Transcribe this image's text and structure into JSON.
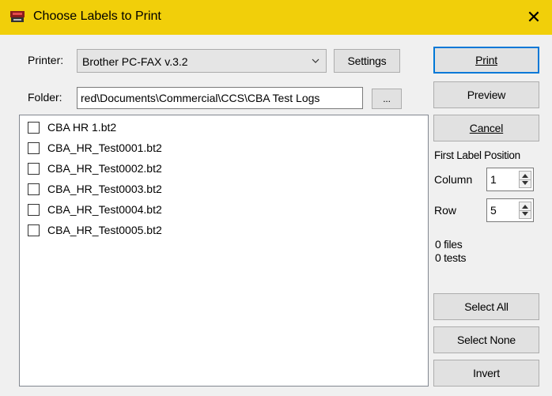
{
  "window": {
    "title": "Choose Labels to Print",
    "close_glyph": "✕",
    "app_icon": "label-printer-icon"
  },
  "printer": {
    "label": "Printer:",
    "selected": "Brother PC-FAX v.3.2",
    "settings_button": "Settings"
  },
  "folder": {
    "label": "Folder:",
    "path_visible": "red\\Documents\\Commercial\\CCS\\CBA Test Logs",
    "browse_button": "..."
  },
  "files": [
    {
      "name": "CBA HR 1.bt2",
      "checked": false
    },
    {
      "name": "CBA_HR_Test0001.bt2",
      "checked": false
    },
    {
      "name": "CBA_HR_Test0002.bt2",
      "checked": false
    },
    {
      "name": "CBA_HR_Test0003.bt2",
      "checked": false
    },
    {
      "name": "CBA_HR_Test0004.bt2",
      "checked": false
    },
    {
      "name": "CBA_HR_Test0005.bt2",
      "checked": false
    }
  ],
  "actions": {
    "print": "Print",
    "preview": "Preview",
    "cancel": "Cancel"
  },
  "first_label_position": {
    "heading": "First Label Position",
    "column_label": "Column",
    "column_value": "1",
    "row_label": "Row",
    "row_value": "5"
  },
  "summary": {
    "files": "0 files",
    "tests": "0 tests"
  },
  "selection": {
    "select_all": "Select All",
    "select_none": "Select None",
    "invert": "Invert"
  },
  "colors": {
    "titlebar": "#f1cf0a",
    "window_bg": "#f0f0f0",
    "default_button_border": "#0078d7"
  }
}
